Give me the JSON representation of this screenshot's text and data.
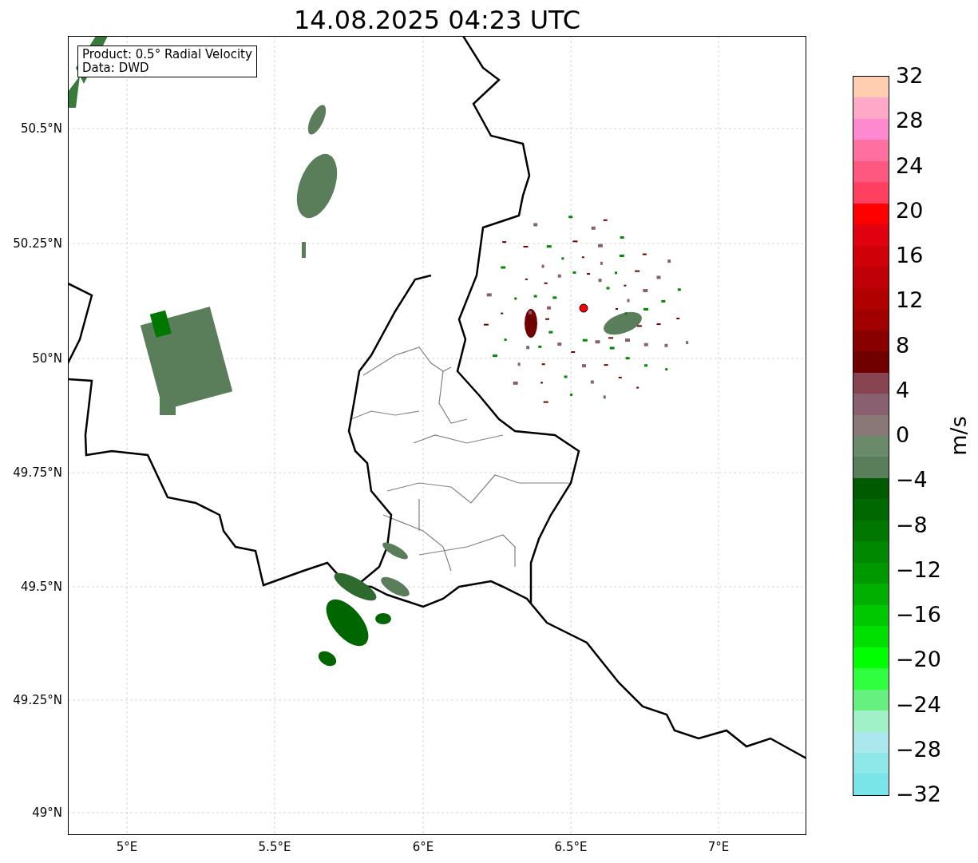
{
  "title": "14.08.2025 04:23 UTC",
  "info_box": [
    "Product: 0.5° Radial Velocity",
    "Data: DWD"
  ],
  "lat_ticks": [
    "50.5°N",
    "50.25°N",
    "50°N",
    "49.75°N",
    "49.5°N",
    "49.25°N",
    "49°N"
  ],
  "lon_ticks": [
    "5°E",
    "5.5°E",
    "6°E",
    "6.5°E",
    "7°E"
  ],
  "colorbar": {
    "label": "m/s",
    "ticks": [
      "32",
      "28",
      "24",
      "20",
      "16",
      "12",
      "8",
      "4",
      "0",
      "−4",
      "−8",
      "−12",
      "−16",
      "−20",
      "−24",
      "−28",
      "−32"
    ],
    "bands": [
      {
        "color": "#ffcdb0"
      },
      {
        "color": "#ffa8c8"
      },
      {
        "color": "#ff88d0"
      },
      {
        "color": "#ff70a0"
      },
      {
        "color": "#ff5880"
      },
      {
        "color": "#ff4060"
      },
      {
        "color": "#ff0000"
      },
      {
        "color": "#e00010"
      },
      {
        "color": "#d00008"
      },
      {
        "color": "#c00008"
      },
      {
        "color": "#b00000"
      },
      {
        "color": "#a00000"
      },
      {
        "color": "#880000"
      },
      {
        "color": "#700000"
      },
      {
        "color": "#884450"
      },
      {
        "color": "#886070"
      },
      {
        "color": "#8a7878"
      },
      {
        "color": "#6a8a6a"
      },
      {
        "color": "#5a7d5a"
      },
      {
        "color": "#005a00"
      },
      {
        "color": "#006800"
      },
      {
        "color": "#007800"
      },
      {
        "color": "#008800"
      },
      {
        "color": "#009800"
      },
      {
        "color": "#00b000"
      },
      {
        "color": "#00c800"
      },
      {
        "color": "#00e000"
      },
      {
        "color": "#00ff00"
      },
      {
        "color": "#30ff40"
      },
      {
        "color": "#66f080"
      },
      {
        "color": "#a0f0c8"
      },
      {
        "color": "#aae8ee"
      },
      {
        "color": "#8ee8ea"
      },
      {
        "color": "#7ae5e8"
      }
    ]
  }
}
